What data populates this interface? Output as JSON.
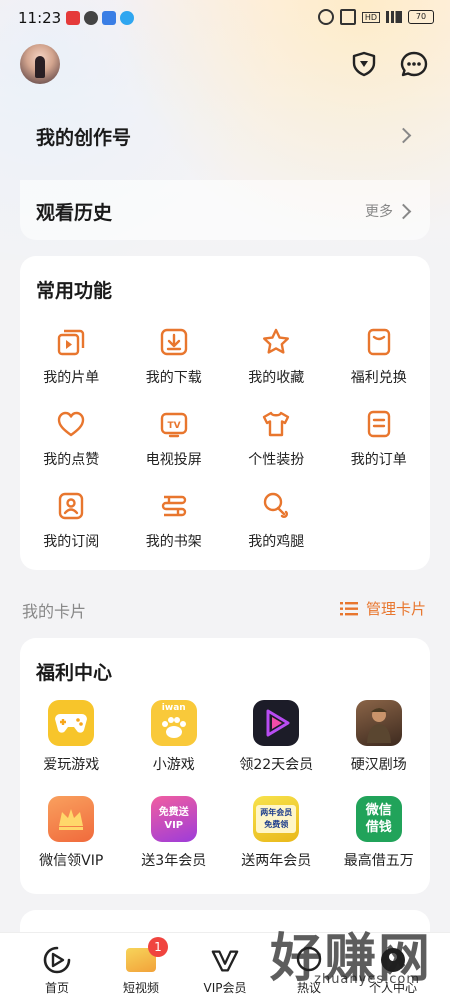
{
  "status_bar": {
    "time": "11:23",
    "battery": "70"
  },
  "header": {
    "avatar": "avatar",
    "shield_icon": "shield-icon",
    "message_icon": "message-icon"
  },
  "creator": {
    "label": "我的创作号"
  },
  "history": {
    "label": "观看历史",
    "more": "更多"
  },
  "common": {
    "title": "常用功能",
    "items": [
      {
        "label": "我的片单",
        "icon": "playlist-icon"
      },
      {
        "label": "我的下载",
        "icon": "download-icon"
      },
      {
        "label": "我的收藏",
        "icon": "star-icon"
      },
      {
        "label": "福利兑换",
        "icon": "gift-card-icon"
      },
      {
        "label": "我的点赞",
        "icon": "heart-icon"
      },
      {
        "label": "电视投屏",
        "icon": "tv-icon"
      },
      {
        "label": "个性装扮",
        "icon": "shirt-icon"
      },
      {
        "label": "我的订单",
        "icon": "order-icon"
      },
      {
        "label": "我的订阅",
        "icon": "subscribe-icon"
      },
      {
        "label": "我的书架",
        "icon": "bookshelf-icon"
      },
      {
        "label": "我的鸡腿",
        "icon": "drumstick-icon"
      }
    ]
  },
  "cards": {
    "label": "我的卡片",
    "manage": "管理卡片"
  },
  "welfare": {
    "title": "福利中心",
    "apps": [
      {
        "label": "爱玩游戏",
        "icon": "gamepad-icon",
        "color": "#f7c52b",
        "text": ""
      },
      {
        "label": "小游戏",
        "icon": "paw-icon",
        "color": "#f9c93a",
        "text": "iwan"
      },
      {
        "label": "领22天会员",
        "icon": "play-logo-icon",
        "color": "#1c1c28",
        "text": ""
      },
      {
        "label": "硬汉剧场",
        "icon": "soldier-icon",
        "color": "#6b4a35",
        "text": ""
      },
      {
        "label": "微信领VIP",
        "icon": "vip-crown-icon",
        "color": "#f68a4c",
        "text": ""
      },
      {
        "label": "送3年会员",
        "icon": "vip-gift-icon",
        "color": "#e04f8e",
        "text": "免费送 VIP"
      },
      {
        "label": "送两年会员",
        "icon": "member-free-icon",
        "color": "#f3d21f",
        "text": "两年会员 免费领"
      },
      {
        "label": "最高借五万",
        "icon": "wechat-loan-icon",
        "color": "#21a35a",
        "text": "微信 借钱"
      }
    ]
  },
  "nav": [
    {
      "label": "首页",
      "icon": "home-play-icon"
    },
    {
      "label": "短视频",
      "icon": "short-video-icon",
      "badge": "1"
    },
    {
      "label": "VIP会员",
      "icon": "vip-icon"
    },
    {
      "label": "热议",
      "icon": "discuss-icon"
    },
    {
      "label": "个人中心",
      "icon": "profile-icon"
    }
  ],
  "watermark": {
    "text": "好赚网",
    "url": "zhuanyes.com"
  }
}
